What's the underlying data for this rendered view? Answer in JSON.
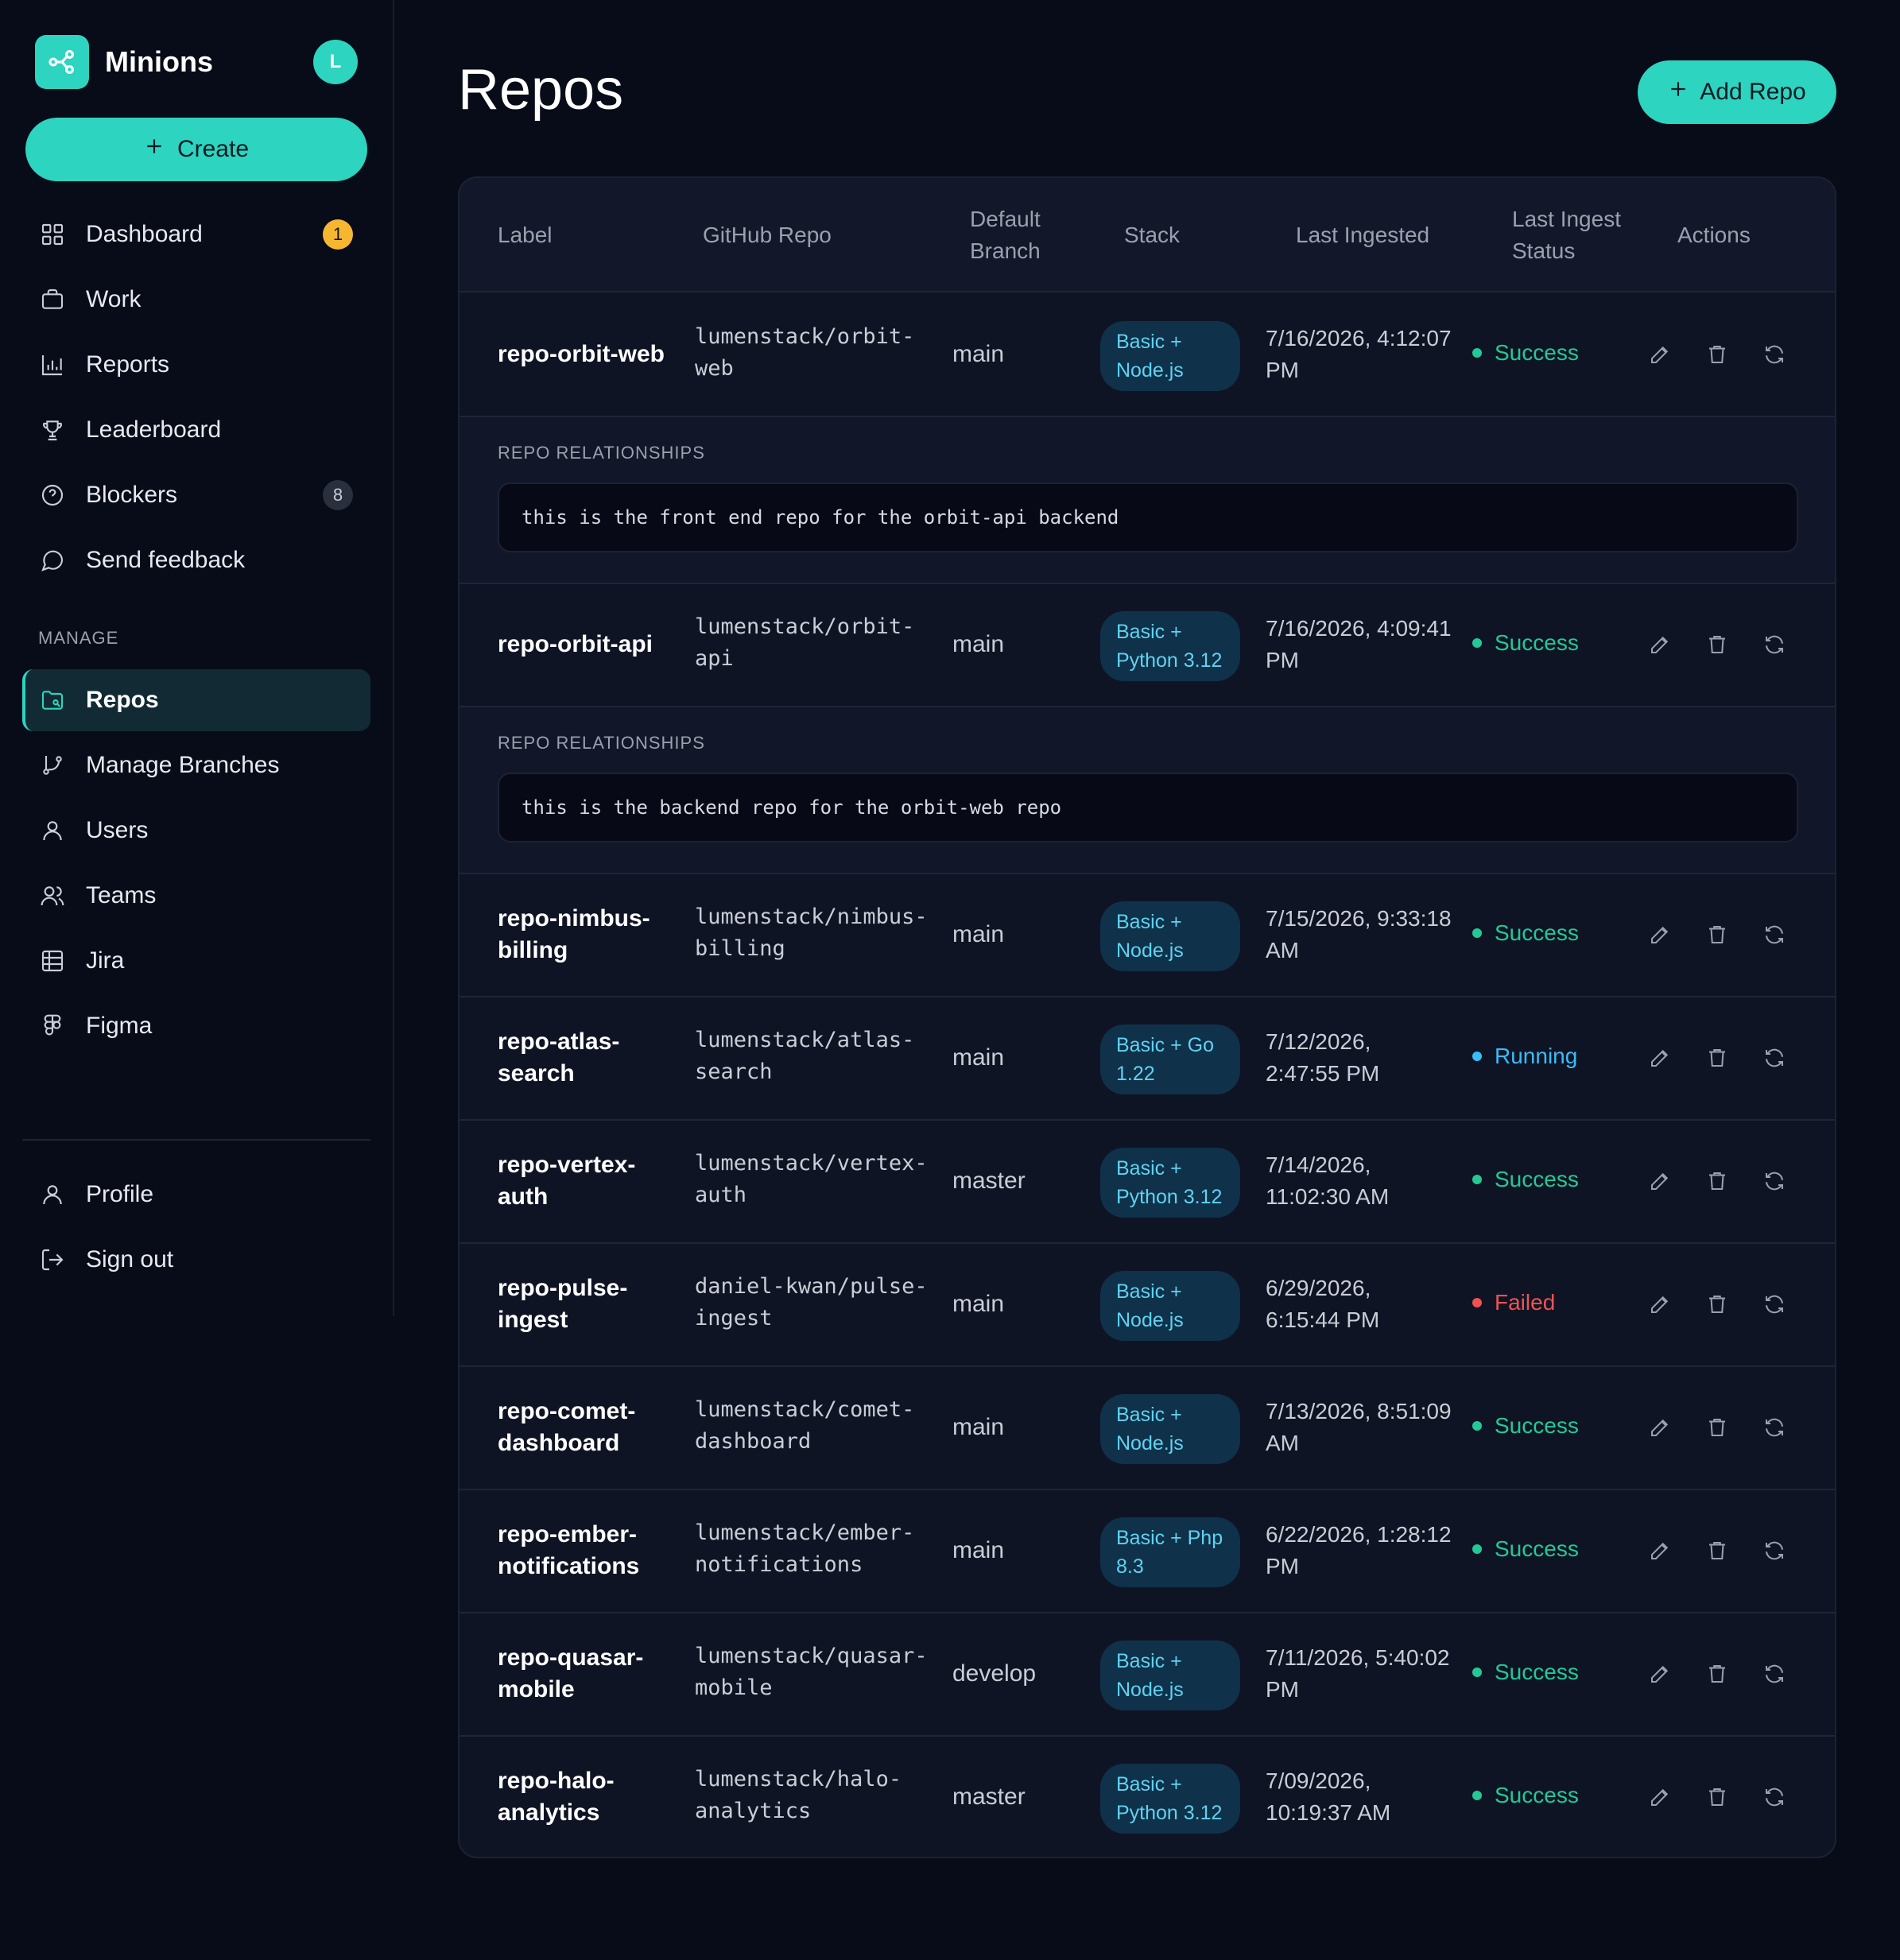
{
  "sidebar": {
    "brand": "Minions",
    "avatar_initial": "L",
    "create_label": "Create",
    "nav": [
      {
        "label": "Dashboard",
        "icon": "grid-icon",
        "badge": "1"
      },
      {
        "label": "Work",
        "icon": "briefcase-icon"
      },
      {
        "label": "Reports",
        "icon": "bar-chart-icon"
      },
      {
        "label": "Leaderboard",
        "icon": "trophy-icon"
      },
      {
        "label": "Blockers",
        "icon": "help-circle-icon",
        "badge": "8"
      },
      {
        "label": "Send feedback",
        "icon": "message-icon"
      }
    ],
    "manage_label": "MANAGE",
    "manage": [
      {
        "label": "Repos",
        "icon": "folder-icon",
        "active": true
      },
      {
        "label": "Manage Branches",
        "icon": "git-branch-icon"
      },
      {
        "label": "Users",
        "icon": "user-icon"
      },
      {
        "label": "Teams",
        "icon": "users-icon"
      },
      {
        "label": "Jira",
        "icon": "table-icon"
      },
      {
        "label": "Figma",
        "icon": "figma-icon"
      }
    ],
    "footer": [
      {
        "label": "Profile",
        "icon": "user-icon"
      },
      {
        "label": "Sign out",
        "icon": "log-out-icon"
      }
    ]
  },
  "main": {
    "title": "Repos",
    "add_label": "Add Repo",
    "columns": {
      "label": "Label",
      "github": "GitHub Repo",
      "branch_1": "Default",
      "branch_2": "Branch",
      "stack": "Stack",
      "last_ingested": "Last Ingested",
      "status_1": "Last Ingest",
      "status_2": "Status",
      "actions": "Actions"
    },
    "relationships_label": "REPO RELATIONSHIPS",
    "rows": [
      {
        "label_1": "repo-orbit-web",
        "label_2": "",
        "repo_1": "lumenstack/orbit-",
        "repo_2": "web",
        "branch": "main",
        "stack_1": "Basic +",
        "stack_2": "Node.js",
        "date_1": "7/16/2026, 4:12:07",
        "date_2": "PM",
        "status": "Success",
        "relationship": "this is the front end repo for the orbit-api backend"
      },
      {
        "label_1": "repo-orbit-api",
        "label_2": "",
        "repo_1": "lumenstack/orbit-",
        "repo_2": "api",
        "branch": "main",
        "stack_1": "Basic +",
        "stack_2": "Python 3.12",
        "date_1": "7/16/2026, 4:09:41",
        "date_2": "PM",
        "status": "Success",
        "relationship": "this is the backend repo for the orbit-web repo"
      },
      {
        "label_1": "repo-nimbus-",
        "label_2": "billing",
        "repo_1": "lumenstack/nimbus-",
        "repo_2": "billing",
        "branch": "main",
        "stack_1": "Basic +",
        "stack_2": "Node.js",
        "date_1": "7/15/2026, 9:33:18",
        "date_2": "AM",
        "status": "Success"
      },
      {
        "label_1": "repo-atlas-",
        "label_2": "search",
        "repo_1": "lumenstack/atlas-",
        "repo_2": "search",
        "branch": "main",
        "stack_1": "Basic + Go",
        "stack_2": "1.22",
        "date_1": "7/12/2026,",
        "date_2": "2:47:55 PM",
        "status": "Running"
      },
      {
        "label_1": "repo-vertex-",
        "label_2": "auth",
        "repo_1": "lumenstack/vertex-",
        "repo_2": "auth",
        "branch": "master",
        "stack_1": "Basic +",
        "stack_2": "Python 3.12",
        "date_1": "7/14/2026,",
        "date_2": "11:02:30 AM",
        "status": "Success"
      },
      {
        "label_1": "repo-pulse-",
        "label_2": "ingest",
        "repo_1": "daniel-kwan/pulse-",
        "repo_2": "ingest",
        "branch": "main",
        "stack_1": "Basic +",
        "stack_2": "Node.js",
        "date_1": "6/29/2026,",
        "date_2": "6:15:44 PM",
        "status": "Failed"
      },
      {
        "label_1": "repo-comet-",
        "label_2": "dashboard",
        "repo_1": "lumenstack/comet-",
        "repo_2": "dashboard",
        "branch": "main",
        "stack_1": "Basic +",
        "stack_2": "Node.js",
        "date_1": "7/13/2026, 8:51:09",
        "date_2": "AM",
        "status": "Success"
      },
      {
        "label_1": "repo-ember-",
        "label_2": "notifications",
        "repo_1": "lumenstack/ember-",
        "repo_2": "notifications",
        "branch": "main",
        "stack_1": "Basic + Php",
        "stack_2": "8.3",
        "date_1": "6/22/2026, 1:28:12",
        "date_2": "PM",
        "status": "Success"
      },
      {
        "label_1": "repo-quasar-",
        "label_2": "mobile",
        "repo_1": "lumenstack/quasar-",
        "repo_2": "mobile",
        "branch": "develop",
        "stack_1": "Basic +",
        "stack_2": "Node.js",
        "date_1": "7/11/2026, 5:40:02",
        "date_2": "PM",
        "status": "Success"
      },
      {
        "label_1": "repo-halo-",
        "label_2": "analytics",
        "repo_1": "lumenstack/halo-",
        "repo_2": "analytics",
        "branch": "master",
        "stack_1": "Basic +",
        "stack_2": "Python 3.12",
        "date_1": "7/09/2026,",
        "date_2": "10:19:37 AM",
        "status": "Success"
      }
    ]
  },
  "colors": {
    "accent": "#2dd4bf",
    "success": "#22c997",
    "running": "#38bdf8",
    "failed": "#f05252",
    "background": "#080b18"
  }
}
